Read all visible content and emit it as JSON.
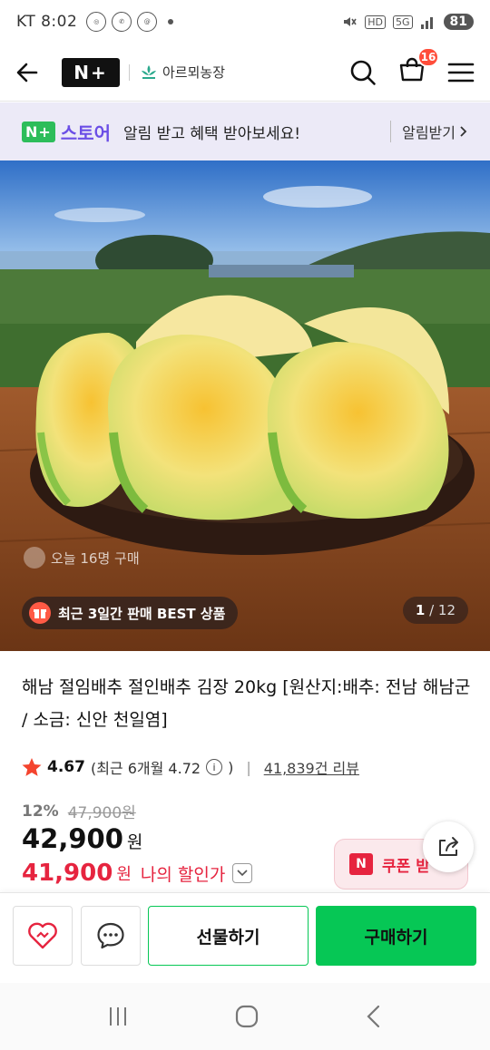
{
  "status_bar": {
    "carrier_time": "KT 8:02",
    "network": "5G",
    "hd": "HD",
    "battery": "81"
  },
  "header": {
    "logo": "N+",
    "store_name": "아르뫼농장",
    "cart_count": "16"
  },
  "banner": {
    "brand": "N+",
    "store_label": "스토어",
    "message": "알림 받고 혜택 받아보세요!",
    "action": "알림받기"
  },
  "hero": {
    "today_purchases": "오늘 16명 구매",
    "best_badge": "최근 3일간 판매 BEST 상품",
    "page_current": "1",
    "page_total": "/ 12"
  },
  "product": {
    "title": "해남 절임배추 절인배추 김장 20kg [원산지:배추: 전남 해남군 / 소금: 신안 천일염]",
    "rating": "4.67",
    "rating_recent": "(최근 6개월 4.72",
    "rating_close": ")",
    "review_count": "41,839건 리뷰",
    "discount_rate": "12%",
    "original_price": "47,900원",
    "price": "42,900",
    "price_unit": "원",
    "my_price": "41,900",
    "my_price_unit": "원",
    "my_price_label": "나의 할인가",
    "coupon_label": "쿠폰 받"
  },
  "actions": {
    "gift": "선물하기",
    "buy": "구매하기"
  },
  "colors": {
    "accent_green": "#06c755",
    "discount_red": "#e6243f",
    "store_purple": "#6b4ee6"
  }
}
